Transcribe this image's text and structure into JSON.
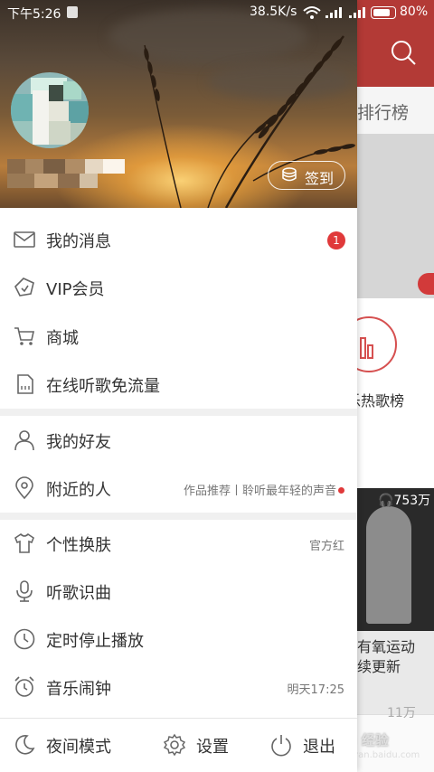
{
  "status_bar": {
    "time": "下午5:26",
    "net_speed": "38.5K/s",
    "battery_pct": "80%",
    "battery_level": 0.8
  },
  "background": {
    "tab_label": "排行榜",
    "chart_label": "乐热歌榜",
    "play_count": "753万",
    "desc_line1": "有氧运动",
    "desc_line2": "续更新",
    "play_count2": "11万",
    "watermark": "Bai 经验",
    "watermark_sub": "jingyan.baidu.com"
  },
  "drawer": {
    "checkin_label": "签到",
    "menu_group1": [
      {
        "label": "我的消息",
        "icon": "mail-icon",
        "badge": "1"
      },
      {
        "label": "VIP会员",
        "icon": "vip-diamond-icon"
      },
      {
        "label": "商城",
        "icon": "cart-icon"
      },
      {
        "label": "在线听歌免流量",
        "icon": "sim-card-icon"
      }
    ],
    "menu_group2": [
      {
        "label": "我的好友",
        "icon": "person-icon"
      },
      {
        "label": "附近的人",
        "icon": "location-pin-icon",
        "right_text": "作品推荐丨聆听最年轻的声音"
      }
    ],
    "menu_group3": [
      {
        "label": "个性换肤",
        "icon": "shirt-icon",
        "right_text": "官方红"
      },
      {
        "label": "听歌识曲",
        "icon": "mic-icon"
      },
      {
        "label": "定时停止播放",
        "icon": "clock-icon"
      },
      {
        "label": "音乐闹钟",
        "icon": "alarm-clock-icon",
        "right_text": "明天17:25"
      }
    ],
    "bottom": {
      "night_mode": "夜间模式",
      "settings": "设置",
      "exit": "退出"
    }
  },
  "colors": {
    "accent_red": "#e0393a",
    "app_bar_red": "#b33a36"
  }
}
